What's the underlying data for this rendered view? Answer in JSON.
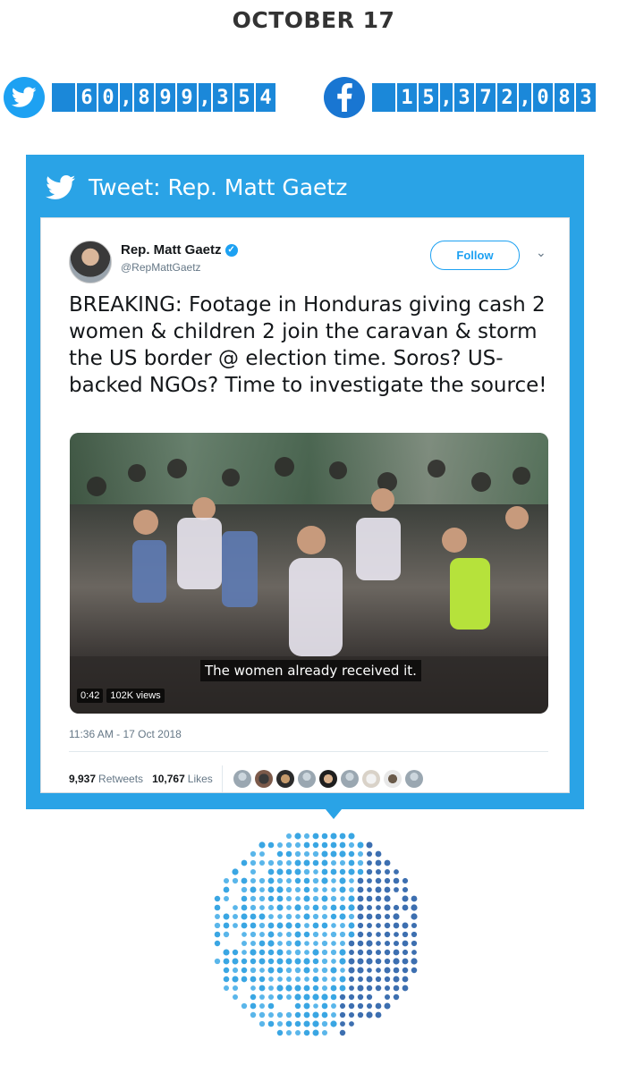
{
  "header": {
    "date": "OCTOBER 17"
  },
  "counters": {
    "twitter": {
      "icon": "twitter-bird-icon",
      "digits": [
        "6",
        "0",
        ",",
        "8",
        "9",
        "9",
        ",",
        "3",
        "5",
        "4"
      ],
      "color": "#1da1f2"
    },
    "facebook": {
      "icon": "facebook-f-icon",
      "digits": [
        "1",
        "5",
        ",",
        "3",
        "7",
        "2",
        ",",
        "0",
        "8",
        "3"
      ],
      "color": "#1976d2"
    }
  },
  "frame": {
    "title": "Tweet: Rep. Matt Gaetz",
    "accent": "#2aa3e6"
  },
  "tweet": {
    "author_name": "Rep. Matt Gaetz",
    "author_handle": "@RepMattGaetz",
    "follow_label": "Follow",
    "chevron": "⌄",
    "verified": "✓",
    "text": "BREAKING: Footage in Honduras giving cash 2 women & children 2 join the caravan & storm the US border @ election time. Soros? US-backed NGOs? Time to investigate the source!",
    "video": {
      "subtitle": "The women already received it.",
      "duration": "0:42",
      "views": "102K views"
    },
    "timestamp": "11:36 AM - 17 Oct 2018",
    "retweets_count": "9,937",
    "retweets_label": "Retweets",
    "likes_count": "10,767",
    "likes_label": "Likes"
  }
}
